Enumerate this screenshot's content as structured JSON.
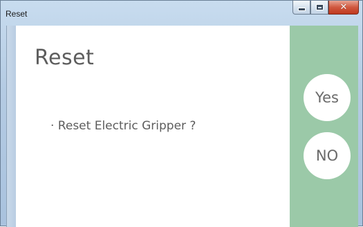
{
  "window": {
    "title": "Reset",
    "controls": {
      "minimize": "minimize",
      "maximize": "maximize",
      "close_glyph": "✕"
    }
  },
  "dialog": {
    "heading": "Reset",
    "question": "· Reset Electric Gripper ?",
    "yes_label": "Yes",
    "no_label": "NO"
  },
  "colors": {
    "side_panel": "#9bc9a8",
    "text": "#5d5d5d"
  },
  "icons": [
    "minimize-icon",
    "maximize-icon",
    "close-icon"
  ]
}
